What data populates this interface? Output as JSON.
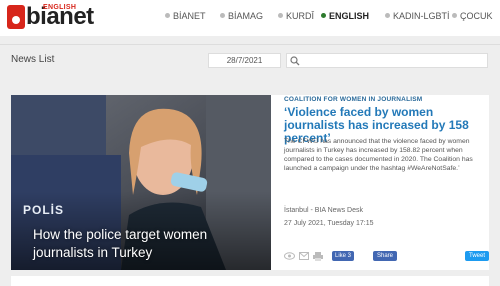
{
  "brand": {
    "name": "bianet",
    "edition": "ENGLISH"
  },
  "nav": [
    {
      "label": "BİANET",
      "active": false
    },
    {
      "label": "BİAMAG",
      "active": false
    },
    {
      "label": "KURDÎ",
      "active": false
    },
    {
      "label": "ENGLISH",
      "active": true
    },
    {
      "label": "KADIN-LGBTİ",
      "active": false
    },
    {
      "label": "ÇOCUK",
      "active": false
    }
  ],
  "header": {
    "title": "News List",
    "date_value": "28/7/2021",
    "search_value": ""
  },
  "article": {
    "photo_caption": "How the police target women journalists in Turkey",
    "photo_text": "POLİS",
    "kicker": "COALITION FOR WOMEN IN JOURNALISM",
    "headline": "‘Violence faced by women journalists has increased by 158 percent’",
    "summary": "The CFWIJ has announced that the violence faced by women journalists in Turkey has increased by 158.82 percent when compared to the cases documented in 2020. The Coalition has launched a campaign under the hashtag #WeAreNotSafe.’",
    "source": "İstanbul - BIA News Desk",
    "date": "27 July 2021, Tuesday 17:15",
    "fb_like": "Like 3",
    "share": "Share",
    "tweet": "Tweet"
  },
  "colors": {
    "brand_red": "#d7261b",
    "headline_blue": "#2379b8",
    "active_nav_dot": "#2d7a2d"
  }
}
